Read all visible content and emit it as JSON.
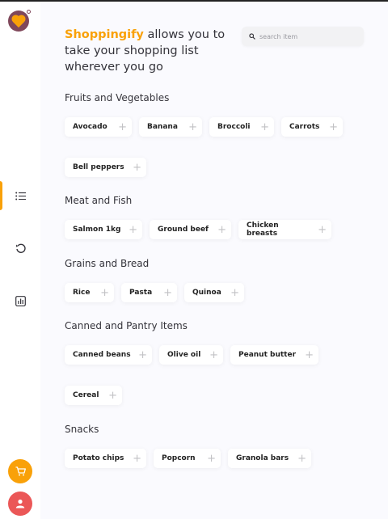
{
  "app": {
    "brand": "Shoppingify",
    "tagline": " allows you to take your shopping list wherever you go"
  },
  "search": {
    "placeholder": "search item"
  },
  "sidebar": {
    "items": [
      {
        "icon": "list-icon",
        "active": true
      },
      {
        "icon": "history-icon",
        "active": false
      },
      {
        "icon": "statistics-icon",
        "active": false
      }
    ]
  },
  "colors": {
    "accent": "#f9a109",
    "logo": "#80485b",
    "user": "#eb5757"
  },
  "categories": [
    {
      "title": "Fruits and Vegetables",
      "items": [
        "Avocado",
        "Banana",
        "Broccoli",
        "Carrots",
        "Bell peppers"
      ]
    },
    {
      "title": "Meat and Fish",
      "items": [
        "Salmon 1kg",
        "Ground beef",
        "Chicken breasts"
      ]
    },
    {
      "title": "Grains and Bread",
      "items": [
        "Rice",
        "Pasta",
        "Quinoa"
      ]
    },
    {
      "title": "Canned and Pantry Items",
      "items": [
        "Canned beans",
        "Olive oil",
        "Peanut butter",
        "Cereal"
      ]
    },
    {
      "title": "Snacks",
      "items": [
        "Potato chips",
        "Popcorn",
        "Granola bars"
      ]
    }
  ],
  "add_glyph": "+"
}
